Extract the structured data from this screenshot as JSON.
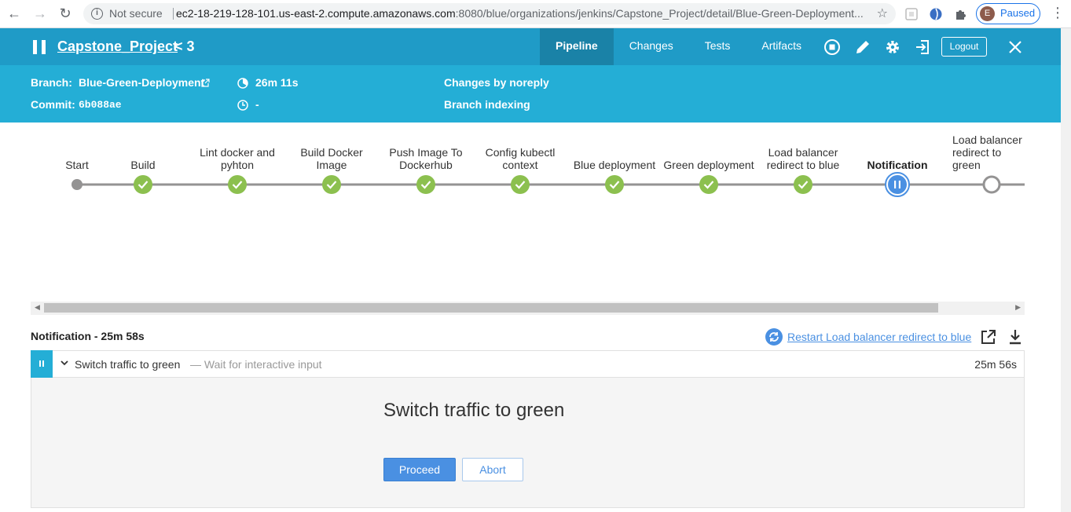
{
  "browser": {
    "security_label": "Not secure",
    "url_host": "ec2-18-219-128-101.us-east-2.compute.amazonaws.com",
    "url_rest": ":8080/blue/organizations/jenkins/Capstone_Project/detail/Blue-Green-Deployment...",
    "profile_initial": "E",
    "profile_status": "Paused"
  },
  "header": {
    "project": "Capstone_Project",
    "run_number": "3",
    "tabs": [
      {
        "label": "Pipeline",
        "active": true
      },
      {
        "label": "Changes",
        "active": false
      },
      {
        "label": "Tests",
        "active": false
      },
      {
        "label": "Artifacts",
        "active": false
      }
    ],
    "logout_label": "Logout"
  },
  "run_info": {
    "branch_label": "Branch:",
    "branch_value": "Blue-Green-Deployment",
    "commit_label": "Commit:",
    "commit_value": "6b088ae",
    "duration": "26m 11s",
    "finished": "-",
    "changes": "Changes by noreply",
    "cause": "Branch indexing"
  },
  "pipeline": {
    "stages": [
      {
        "label": "Start",
        "status": "start"
      },
      {
        "label": "Build",
        "status": "success"
      },
      {
        "label": "Lint docker and pyhton",
        "status": "success"
      },
      {
        "label": "Build Docker Image",
        "status": "success"
      },
      {
        "label": "Push Image To Dockerhub",
        "status": "success"
      },
      {
        "label": "Config kubectl context",
        "status": "success"
      },
      {
        "label": "Blue deployment",
        "status": "success"
      },
      {
        "label": "Green deployment",
        "status": "success"
      },
      {
        "label": "Load balancer redirect to blue",
        "status": "success"
      },
      {
        "label": "Notification",
        "status": "paused"
      },
      {
        "label": "Load balancer redirect to green",
        "status": "not_built"
      }
    ],
    "colors": {
      "success": "#8cc04f",
      "paused": "#4a90e2",
      "line": "#949393",
      "start": "#949393"
    }
  },
  "step": {
    "title": "Notification - 25m 58s",
    "restart_label": "Restart Load balancer redirect to blue",
    "row_name": "Switch traffic to green",
    "row_desc": "— Wait for interactive input",
    "row_duration": "25m 56s",
    "input_message": "Switch traffic to green",
    "proceed_label": "Proceed",
    "abort_label": "Abort"
  }
}
